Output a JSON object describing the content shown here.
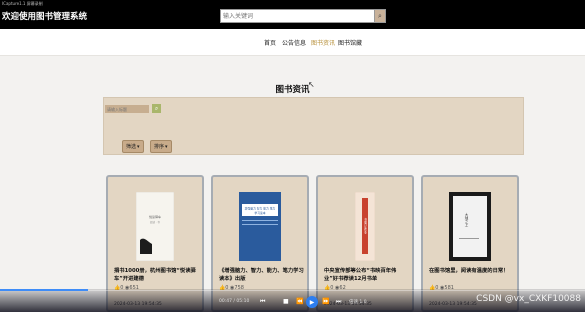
{
  "window": {
    "tiny_title": "ICapture1.1 屏幕录制",
    "app_title": "欢迎使用图书管理系统"
  },
  "search": {
    "placeholder": "输入关键词"
  },
  "nav": {
    "items": [
      {
        "label": "首页"
      },
      {
        "label": "公告信息"
      },
      {
        "label": "图书资讯"
      },
      {
        "label": "图书馆藏"
      }
    ],
    "active_index": 2
  },
  "section": {
    "title": "图书资讯"
  },
  "filter": {
    "input_placeholder": "请输入标题",
    "buttons": [
      {
        "label": "筛选"
      },
      {
        "label": "排序"
      }
    ]
  },
  "cards": [
    {
      "title": "捐书1000册，杭州图书馆“悦读驿车”开进建德",
      "likes": "0",
      "views": "651",
      "date": "2024-03-13 19:54:35",
      "cover_text_1": "悦读驿车",
      "cover_text_2": "阅读 · 书",
      "cover_color": "#f6f4ee"
    },
    {
      "title": "《增强脑力、智力、能力、笔力学习读本》出版",
      "likes": "0",
      "views": "758",
      "date": "",
      "cover_text_1": "增强脑力 智力 能力 笔力",
      "cover_text_2": "学习读本",
      "cover_color": "#2a5b9d"
    },
    {
      "title": "中央宣传部等公布“书映百年伟业”好书荐读12月书单",
      "likes": "0",
      "views": "62",
      "date": "2024-03-13 19:54:35",
      "cover_text_1": "书映百年伟业",
      "cover_text_2": "",
      "cover_color": "#f4e4d6"
    },
    {
      "title": "在图书馆里，阅读有温度的日常！",
      "likes": "0",
      "views": "581",
      "date": "2024-03-13 19:54:35",
      "cover_text_1": "大地之上",
      "cover_text_2": "",
      "cover_color": "#f2f2f2"
    }
  ],
  "video": {
    "time": "00:47 / 05:10",
    "speed": "倍速 1.0",
    "progress_fraction": 0.15
  },
  "watermark": "CSDN @vx_CXKF10088",
  "colors": {
    "accent": "#b8923d",
    "panel": "#e3d6c3",
    "card_border": "#a6acb3",
    "topbar": "#000000"
  }
}
